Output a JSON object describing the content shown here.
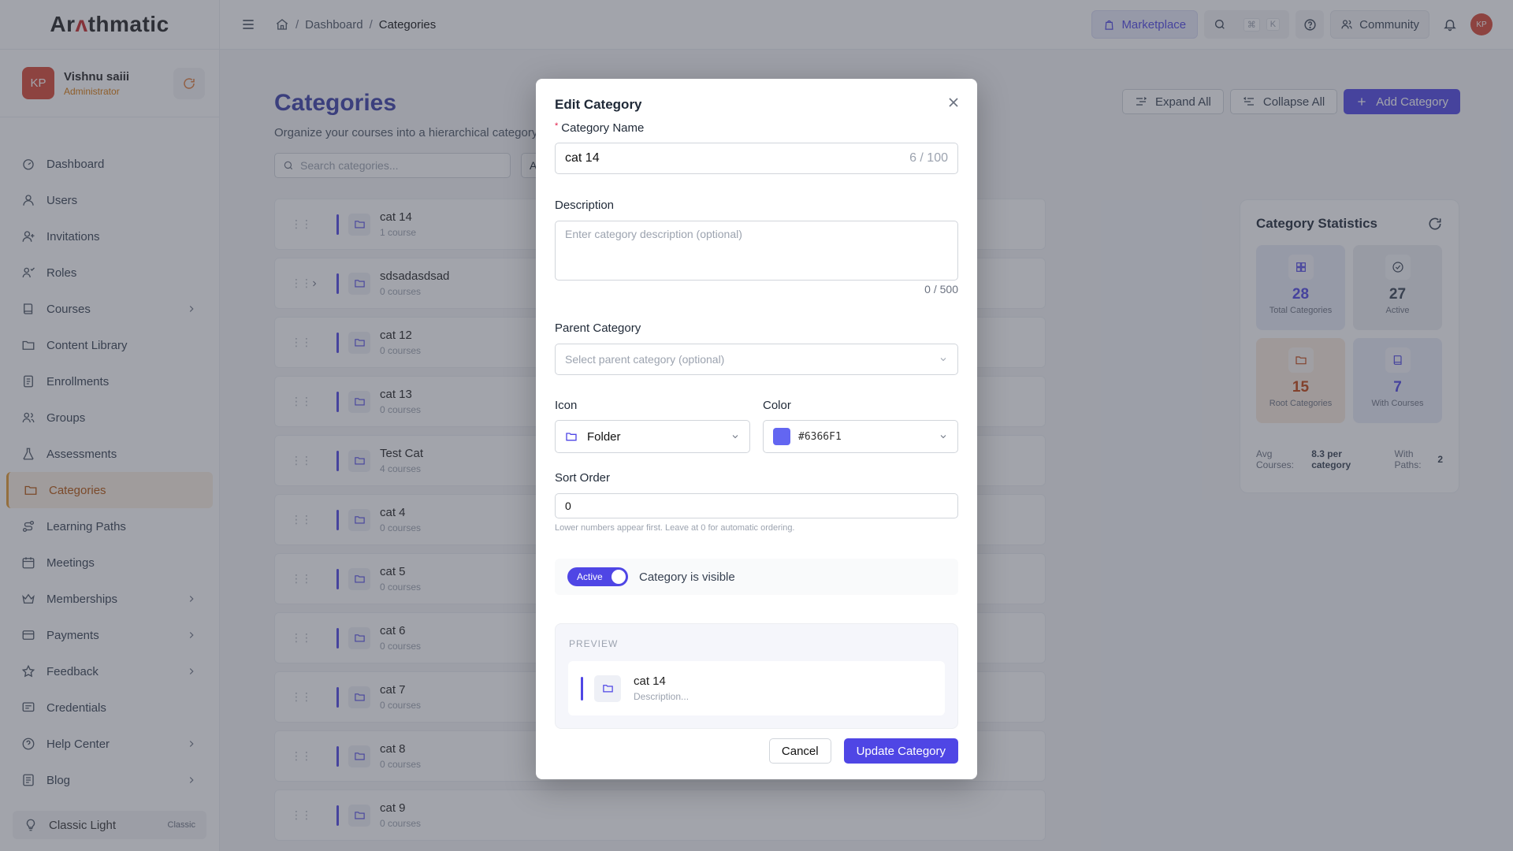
{
  "brand": {
    "logo_prefix": "Ar",
    "logo_mark": "ʌ",
    "logo_suffix": "thmatic"
  },
  "user": {
    "initials": "KP",
    "name": "Vishnu saiii",
    "role": "Administrator"
  },
  "sidebar": {
    "items": [
      {
        "label": "Dashboard",
        "icon": "dashboard-icon",
        "has_children": false
      },
      {
        "label": "Users",
        "icon": "user-icon",
        "has_children": false
      },
      {
        "label": "Invitations",
        "icon": "user-plus-icon",
        "has_children": false
      },
      {
        "label": "Roles",
        "icon": "roles-icon",
        "has_children": false
      },
      {
        "label": "Courses",
        "icon": "book-icon",
        "has_children": true
      },
      {
        "label": "Content Library",
        "icon": "folder-icon",
        "has_children": false
      },
      {
        "label": "Enrollments",
        "icon": "enrollment-icon",
        "has_children": false
      },
      {
        "label": "Groups",
        "icon": "group-icon",
        "has_children": false
      },
      {
        "label": "Assessments",
        "icon": "flask-icon",
        "has_children": false
      },
      {
        "label": "Categories",
        "icon": "folder-icon",
        "has_children": false,
        "active": true
      },
      {
        "label": "Learning Paths",
        "icon": "route-icon",
        "has_children": false
      },
      {
        "label": "Meetings",
        "icon": "calendar-icon",
        "has_children": false
      },
      {
        "label": "Memberships",
        "icon": "crown-icon",
        "has_children": true
      },
      {
        "label": "Payments",
        "icon": "card-icon",
        "has_children": true
      },
      {
        "label": "Feedback",
        "icon": "star-icon",
        "has_children": true
      },
      {
        "label": "Credentials",
        "icon": "certificate-icon",
        "has_children": false
      },
      {
        "label": "Help Center",
        "icon": "help-icon",
        "has_children": true
      },
      {
        "label": "Blog",
        "icon": "blog-icon",
        "has_children": true
      }
    ],
    "theme": {
      "label": "Classic Light",
      "tag": "Classic"
    }
  },
  "topbar": {
    "breadcrumb": [
      "Dashboard",
      "Categories"
    ],
    "marketplace_label": "Marketplace",
    "shortcut_keys": [
      "⌘",
      "K"
    ],
    "community_label": "Community",
    "avatar_initials": "KP"
  },
  "page": {
    "title": "Categories",
    "subtitle": "Organize your courses into a hierarchical category s",
    "expand_all": "Expand All",
    "collapse_all": "Collapse All",
    "add_category": "Add Category",
    "search_placeholder": "Search categories...",
    "filter_value": "A"
  },
  "categories": [
    {
      "name": "cat 14",
      "count": "1 course",
      "expandable": false
    },
    {
      "name": "sdsadasdsad",
      "count": "0 courses",
      "expandable": true
    },
    {
      "name": "cat 12",
      "count": "0 courses",
      "expandable": false
    },
    {
      "name": "cat 13",
      "count": "0 courses",
      "expandable": false
    },
    {
      "name": "Test Cat",
      "count": "4 courses",
      "expandable": false
    },
    {
      "name": "cat 4",
      "count": "0 courses",
      "expandable": false
    },
    {
      "name": "cat 5",
      "count": "0 courses",
      "expandable": false
    },
    {
      "name": "cat 6",
      "count": "0 courses",
      "expandable": false
    },
    {
      "name": "cat 7",
      "count": "0 courses",
      "expandable": false
    },
    {
      "name": "cat 8",
      "count": "0 courses",
      "expandable": false
    },
    {
      "name": "cat 9",
      "count": "0 courses",
      "expandable": false
    }
  ],
  "stats": {
    "title": "Category Statistics",
    "tiles": [
      {
        "value": "28",
        "label": "Total Categories",
        "icon": "grid-icon",
        "bg": "#e8ebf7",
        "color": "#4f46e5"
      },
      {
        "value": "27",
        "label": "Active",
        "icon": "check-circle-icon",
        "bg": "#eceef2",
        "color": "#374151"
      },
      {
        "value": "15",
        "label": "Root Categories",
        "icon": "folder-icon",
        "bg": "#f9eadc",
        "color": "#c2410c"
      },
      {
        "value": "7",
        "label": "With Courses",
        "icon": "book-icon",
        "bg": "#e8ebf7",
        "color": "#4f46e5"
      }
    ],
    "avg_label": "Avg Courses:",
    "avg_value": "8.3 per category",
    "paths_label": "With Paths:",
    "paths_value": "2"
  },
  "modal": {
    "title": "Edit Category",
    "name_label": "Category Name",
    "name_value": "cat 14",
    "name_counter": "6 / 100",
    "description_label": "Description",
    "description_placeholder": "Enter category description (optional)",
    "description_counter": "0 / 500",
    "parent_label": "Parent Category",
    "parent_placeholder": "Select parent category (optional)",
    "icon_label": "Icon",
    "icon_value": "Folder",
    "color_label": "Color",
    "color_value": "#6366F1",
    "sort_label": "Sort Order",
    "sort_value": "0",
    "sort_help": "Lower numbers appear first. Leave at 0 for automatic ordering.",
    "toggle_label": "Active",
    "toggle_text": "Category is visible",
    "toggle_on": true,
    "preview_label": "PREVIEW",
    "preview_name": "cat 14",
    "preview_desc": "Description...",
    "cancel": "Cancel",
    "update": "Update Category"
  },
  "colors": {
    "accent": "#4f46e5",
    "active_nav_bg": "#fbefe2",
    "active_nav_text": "#b45309",
    "avatar": "#d64532"
  }
}
